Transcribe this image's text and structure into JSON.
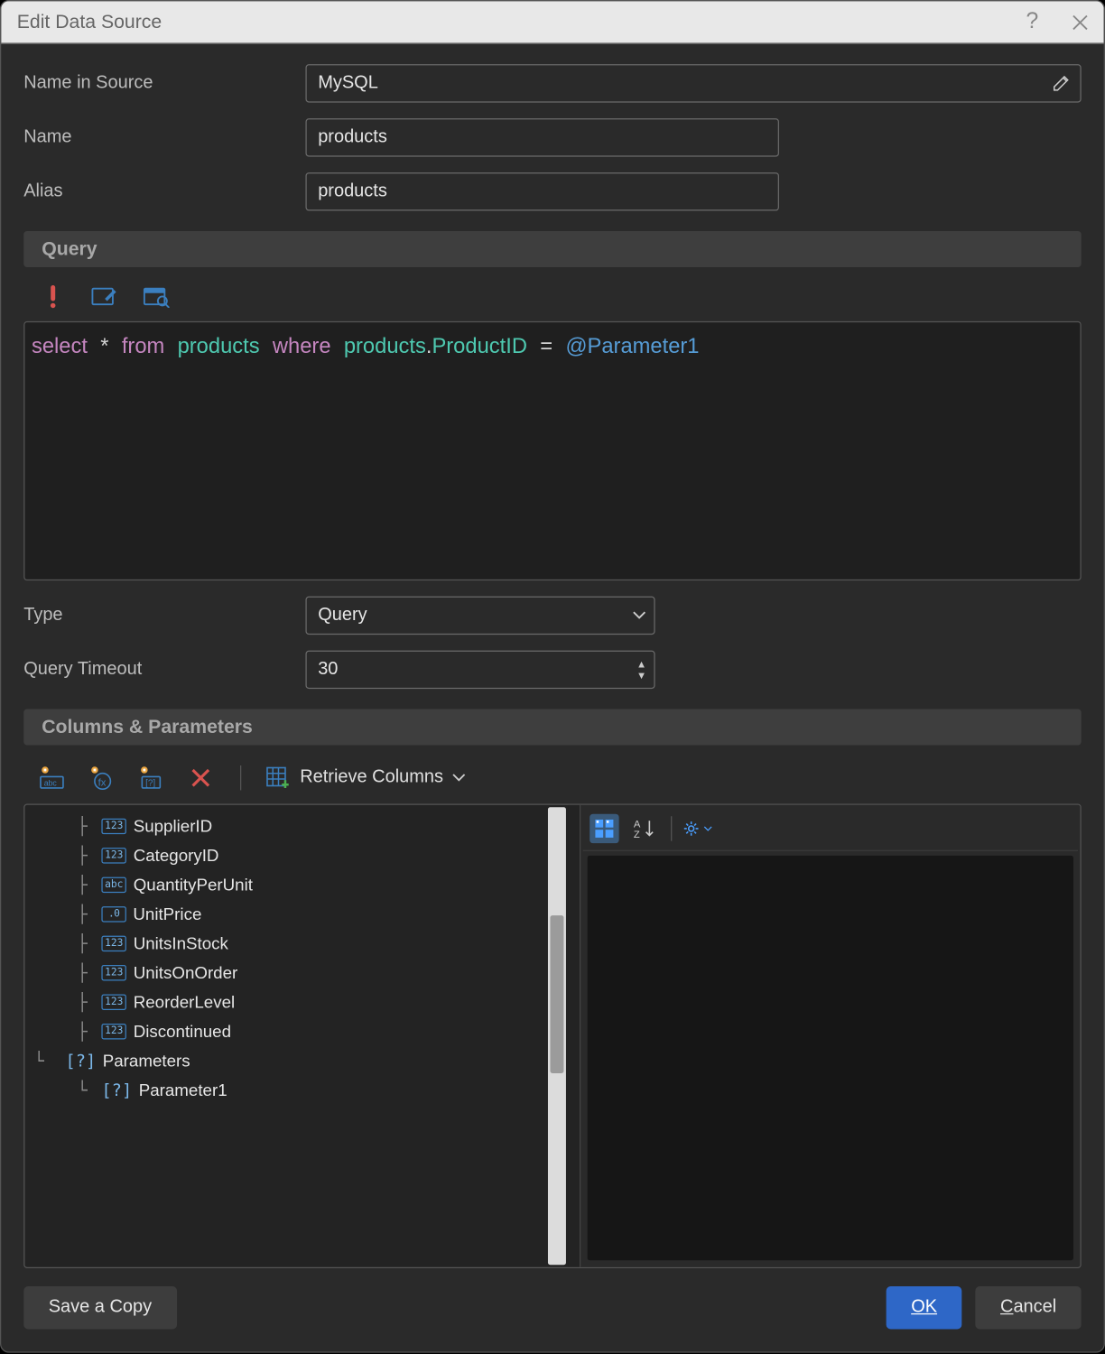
{
  "title": "Edit Data Source",
  "form": {
    "name_in_source_label": "Name in Source",
    "name_in_source": "MySQL",
    "name_label": "Name",
    "name": "products",
    "alias_label": "Alias",
    "alias": "products"
  },
  "section_query": "Query",
  "sql": {
    "select": "select",
    "star": "*",
    "from": "from",
    "table": "products",
    "where": "where",
    "qual_table": "products",
    "dot": ".",
    "column": "ProductID",
    "eq": "=",
    "param": "@Parameter1"
  },
  "type_label": "Type",
  "type_value": "Query",
  "timeout_label": "Query Timeout",
  "timeout_value": "30",
  "section_cp": "Columns & Parameters",
  "retrieve_label": "Retrieve Columns",
  "columns": [
    {
      "name": "SupplierID",
      "type": "123"
    },
    {
      "name": "CategoryID",
      "type": "123"
    },
    {
      "name": "QuantityPerUnit",
      "type": "abc"
    },
    {
      "name": "UnitPrice",
      "type": ".0"
    },
    {
      "name": "UnitsInStock",
      "type": "123"
    },
    {
      "name": "UnitsOnOrder",
      "type": "123"
    },
    {
      "name": "ReorderLevel",
      "type": "123"
    },
    {
      "name": "Discontinued",
      "type": "123"
    }
  ],
  "params_node": "Parameters",
  "params": [
    {
      "name": "Parameter1"
    }
  ],
  "footer": {
    "save_copy": "Save a Copy",
    "ok": "OK",
    "cancel": "Cancel"
  }
}
